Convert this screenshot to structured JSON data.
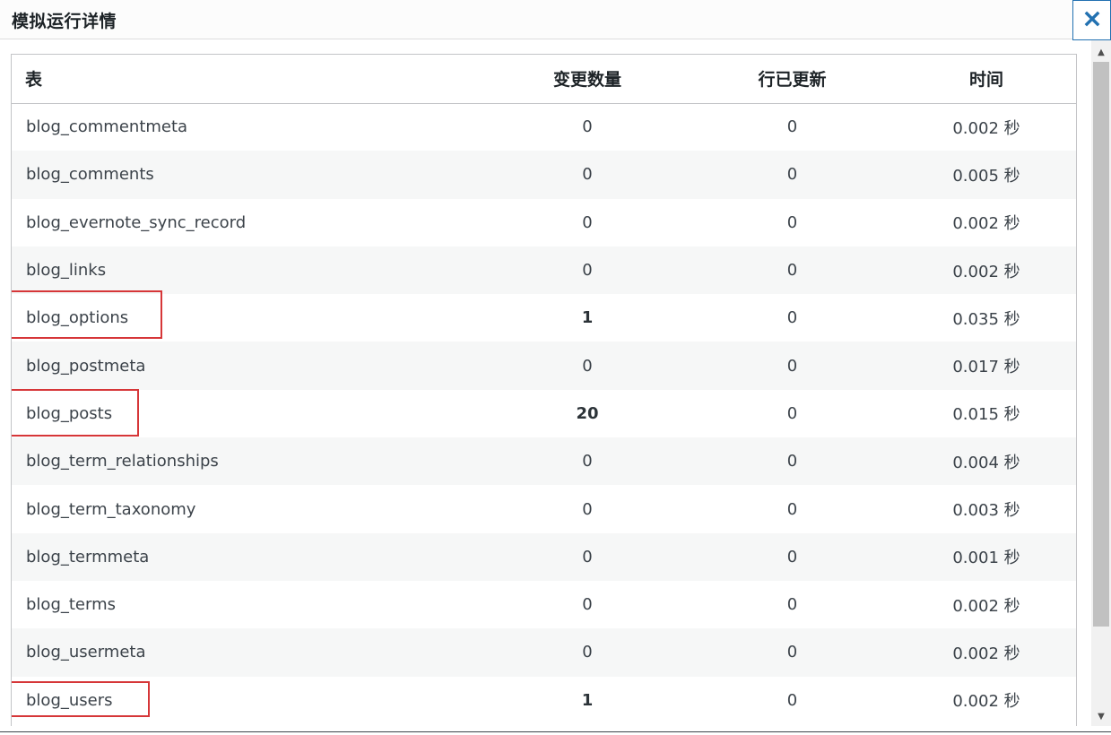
{
  "modal": {
    "title": "模拟运行详情",
    "close_icon": "close-icon"
  },
  "table": {
    "headers": [
      "表",
      "变更数量",
      "行已更新",
      "时间"
    ],
    "rows": [
      {
        "table": "blog_commentmeta",
        "changes": "0",
        "updated": "0",
        "time": "0.002 秒"
      },
      {
        "table": "blog_comments",
        "changes": "0",
        "updated": "0",
        "time": "0.005 秒"
      },
      {
        "table": "blog_evernote_sync_record",
        "changes": "0",
        "updated": "0",
        "time": "0.002 秒"
      },
      {
        "table": "blog_links",
        "changes": "0",
        "updated": "0",
        "time": "0.002 秒"
      },
      {
        "table": "blog_options",
        "changes": "1",
        "updated": "0",
        "time": "0.035 秒"
      },
      {
        "table": "blog_postmeta",
        "changes": "0",
        "updated": "0",
        "time": "0.017 秒"
      },
      {
        "table": "blog_posts",
        "changes": "20",
        "updated": "0",
        "time": "0.015 秒"
      },
      {
        "table": "blog_term_relationships",
        "changes": "0",
        "updated": "0",
        "time": "0.004 秒"
      },
      {
        "table": "blog_term_taxonomy",
        "changes": "0",
        "updated": "0",
        "time": "0.003 秒"
      },
      {
        "table": "blog_termmeta",
        "changes": "0",
        "updated": "0",
        "time": "0.001 秒"
      },
      {
        "table": "blog_terms",
        "changes": "0",
        "updated": "0",
        "time": "0.002 秒"
      },
      {
        "table": "blog_usermeta",
        "changes": "0",
        "updated": "0",
        "time": "0.002 秒"
      },
      {
        "table": "blog_users",
        "changes": "1",
        "updated": "0",
        "time": "0.002 秒"
      }
    ]
  },
  "colors": {
    "highlight": "#d63638",
    "close_border": "#2271b1",
    "close_icon": "#2271b1",
    "row_alt": "#f6f7f7"
  }
}
